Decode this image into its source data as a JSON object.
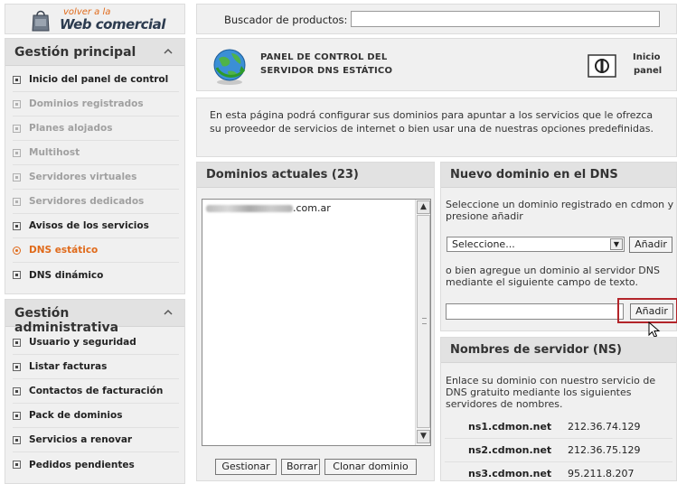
{
  "logo": {
    "line1": "volver a la",
    "line2": "Web comercial"
  },
  "sidebar": {
    "section1": {
      "title": "Gestión principal",
      "items": [
        {
          "label": "Inicio del panel de control",
          "state": "normal"
        },
        {
          "label": "Dominios registrados",
          "state": "disabled"
        },
        {
          "label": "Planes alojados",
          "state": "disabled"
        },
        {
          "label": "Multihost",
          "state": "disabled"
        },
        {
          "label": "Servidores virtuales",
          "state": "disabled"
        },
        {
          "label": "Servidores dedicados",
          "state": "disabled"
        },
        {
          "label": "Avisos de los servicios",
          "state": "normal"
        },
        {
          "label": "DNS estático",
          "state": "active"
        },
        {
          "label": "DNS dinámico",
          "state": "normal"
        }
      ]
    },
    "section2": {
      "title": "Gestión administrativa",
      "items": [
        {
          "label": "Usuario y seguridad"
        },
        {
          "label": "Listar facturas"
        },
        {
          "label": "Contactos de facturación"
        },
        {
          "label": "Pack de dominios"
        },
        {
          "label": "Servicios a renovar"
        },
        {
          "label": "Pedidos pendientes"
        }
      ]
    }
  },
  "search": {
    "label": "Buscador de productos:",
    "value": ""
  },
  "title": {
    "line1": "PANEL DE CONTROL DEL",
    "line2": "SERVIDOR DNS ESTÁTICO",
    "home_line1": "Inicio",
    "home_line2": "panel"
  },
  "info": {
    "text": "En esta página podrá configurar sus dominios para apuntar a los servicios que le ofrezca su proveedor de servicios de internet o bien usar una de nuestras opciones predefinidas."
  },
  "current": {
    "title": "Dominios actuales (23)",
    "domain_suffix": ".com.ar",
    "buttons": {
      "manage": "Gestionar",
      "delete": "Borrar",
      "clone": "Clonar dominio"
    }
  },
  "new_domain": {
    "title": "Nuevo dominio en el DNS",
    "text1": "Seleccione un dominio registrado en cdmon y presione añadir",
    "select_value": "Seleccione...",
    "add_label": "Añadir",
    "text2": "o bien agregue un dominio al servidor DNS mediante el siguiente campo de texto.",
    "input_value": ""
  },
  "nameservers": {
    "title": "Nombres de servidor (NS)",
    "text": "Enlace su dominio con nuestro servicio de DNS gratuito mediante los siguientes servidores de nombres.",
    "servers": [
      {
        "name": "ns1.cdmon.net",
        "ip": "212.36.74.129"
      },
      {
        "name": "ns2.cdmon.net",
        "ip": "212.36.75.129"
      },
      {
        "name": "ns3.cdmon.net",
        "ip": "95.211.8.207"
      }
    ]
  }
}
